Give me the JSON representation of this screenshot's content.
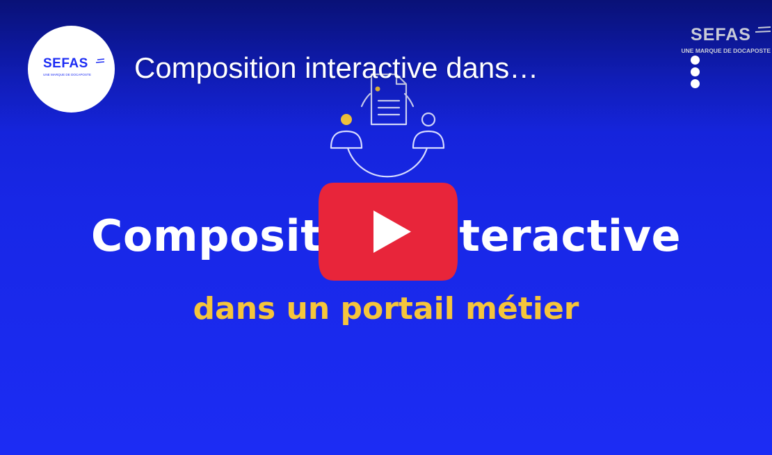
{
  "channel": {
    "avatar_brand": "SEFAS",
    "avatar_tagline": "UNE MARQUE DE DOCAPOSTE"
  },
  "video": {
    "title": "Composition interactive dans…"
  },
  "thumbnail": {
    "title_line": "Composition interactive",
    "subtitle_line": "dans un portail métier",
    "watermark_brand": "SEFAS",
    "watermark_tagline": "UNE MARQUE DE DOCAPOSTE"
  },
  "icons": {
    "more": "more-vertical-icon",
    "play": "play-icon",
    "illustration": "document-people-cycle-icon"
  },
  "colors": {
    "background": "#1c2cf4",
    "title_text": "#ffffff",
    "subtitle_text": "#f5c53b",
    "play_button": "#e8253a",
    "watermark": "#c9ccd8"
  }
}
